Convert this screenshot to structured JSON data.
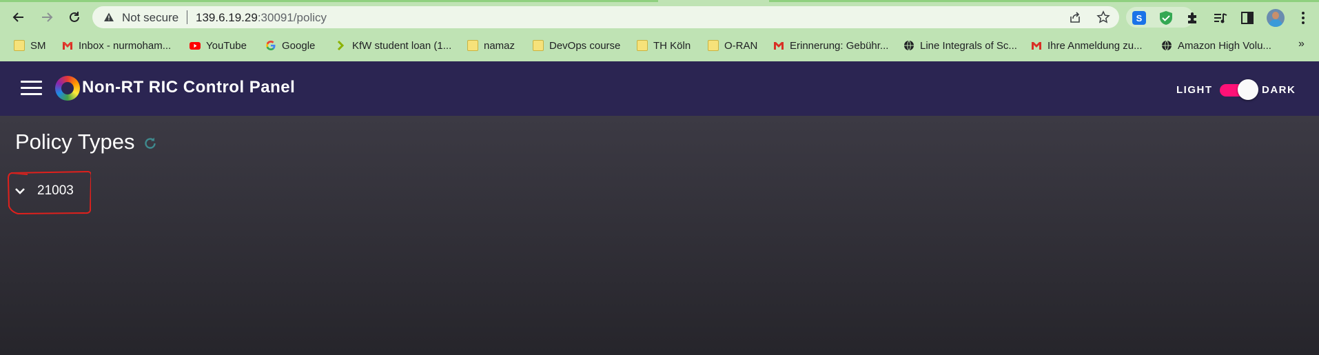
{
  "browser": {
    "security_label": "Not secure",
    "url_host": "139.6.19.29",
    "url_rest": ":30091/policy",
    "bookmarks": [
      {
        "label": "SM",
        "icon": "folder-icon"
      },
      {
        "label": "Inbox - nurmoham...",
        "icon": "gmail-icon"
      },
      {
        "label": "YouTube",
        "icon": "youtube-icon"
      },
      {
        "label": "Google",
        "icon": "google-icon"
      },
      {
        "label": "KfW student loan (1...",
        "icon": "kfw-icon"
      },
      {
        "label": "namaz",
        "icon": "folder-icon"
      },
      {
        "label": "DevOps course",
        "icon": "folder-icon"
      },
      {
        "label": "TH Köln",
        "icon": "folder-icon"
      },
      {
        "label": "O-RAN",
        "icon": "folder-icon"
      },
      {
        "label": "Erinnerung: Gebühr...",
        "icon": "gmail-icon"
      },
      {
        "label": "Line Integrals of Sc...",
        "icon": "globe-icon"
      },
      {
        "label": "Ihre Anmeldung zu...",
        "icon": "gmail-icon"
      },
      {
        "label": "Amazon High Volu...",
        "icon": "globe-icon"
      }
    ],
    "more_label": "»"
  },
  "app": {
    "title": "Non-RT RIC Control Panel",
    "theme_light_label": "LIGHT",
    "theme_dark_label": "DARK",
    "dark_mode_on": true
  },
  "page": {
    "title": "Policy Types",
    "policy_types": [
      {
        "id": "21003",
        "expanded": false
      }
    ]
  },
  "colors": {
    "chrome_bg": "#bfe3b4",
    "header_bg": "#2b2552",
    "toggle_accent": "#ff1177",
    "annotation": "#e0201c",
    "content_bg": "#2a2930"
  }
}
